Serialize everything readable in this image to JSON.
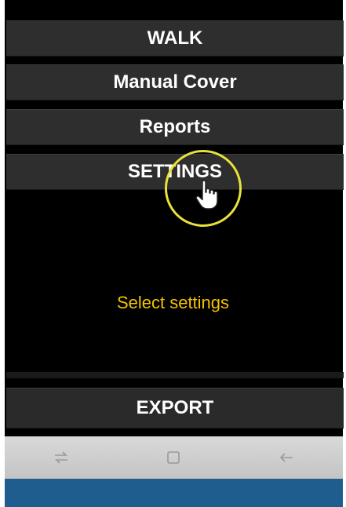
{
  "menu": {
    "walk_label": "WALK",
    "manual_cover_label": "Manual Cover",
    "reports_label": "Reports",
    "settings_label": "SETTINGS",
    "export_label": "EXPORT"
  },
  "caption": "Select settings",
  "navbar": {
    "recents_icon": "recents-icon",
    "home_icon": "home-icon",
    "back_icon": "back-icon"
  },
  "colors": {
    "caption": "#f2c200",
    "highlight": "#e8e23a",
    "bottom_strip": "#1f5d8e"
  }
}
